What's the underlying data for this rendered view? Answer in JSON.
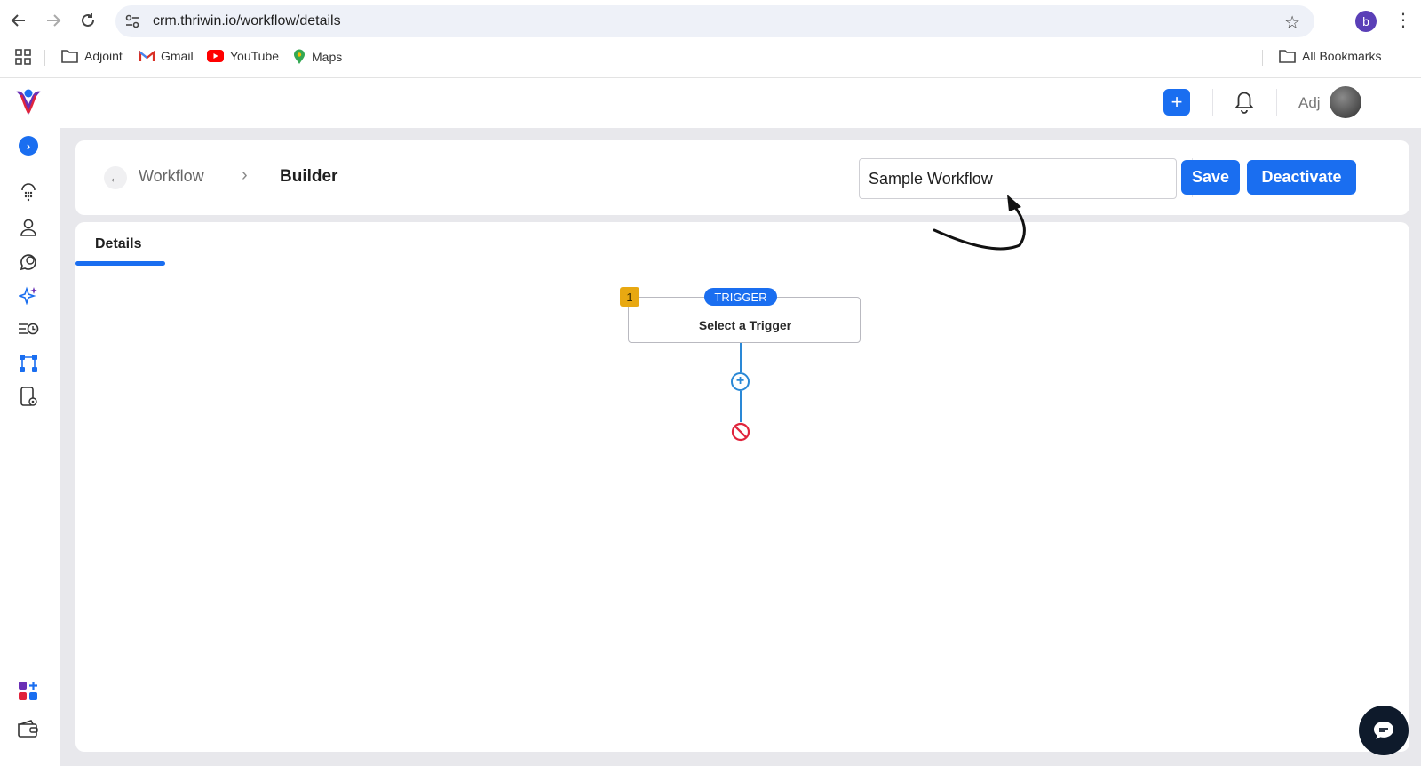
{
  "browser": {
    "url": "crm.thriwin.io/workflow/details",
    "profile_initial": "b",
    "bookmarks": [
      {
        "label": "Adjoint",
        "icon": "folder-icon"
      },
      {
        "label": "Gmail",
        "icon": "gmail-icon"
      },
      {
        "label": "YouTube",
        "icon": "youtube-icon"
      },
      {
        "label": "Maps",
        "icon": "maps-icon"
      }
    ],
    "all_bookmarks": "All Bookmarks"
  },
  "topbar": {
    "user_name": "Adj"
  },
  "header": {
    "breadcrumb_parent": "Workflow",
    "breadcrumb_current": "Builder",
    "workflow_name": "Sample Workflow",
    "save_label": "Save",
    "deactivate_label": "Deactivate"
  },
  "tabs": [
    {
      "label": "Details",
      "active": true
    }
  ],
  "canvas": {
    "step_number": "1",
    "trigger_tag": "TRIGGER",
    "trigger_text": "Select a Trigger"
  },
  "colors": {
    "accent": "#1a6ef0",
    "step_badge": "#e8a811",
    "stop": "#e0243c",
    "connector": "#2a88d6"
  },
  "sidebar_icons": [
    "expand-icon",
    "contacts-dots-icon",
    "user-icon",
    "chat-bubbles-icon",
    "sparkle-icon",
    "list-clock-icon",
    "workflow-icon",
    "device-settings-icon",
    "apps-add-icon",
    "wallet-icon"
  ]
}
